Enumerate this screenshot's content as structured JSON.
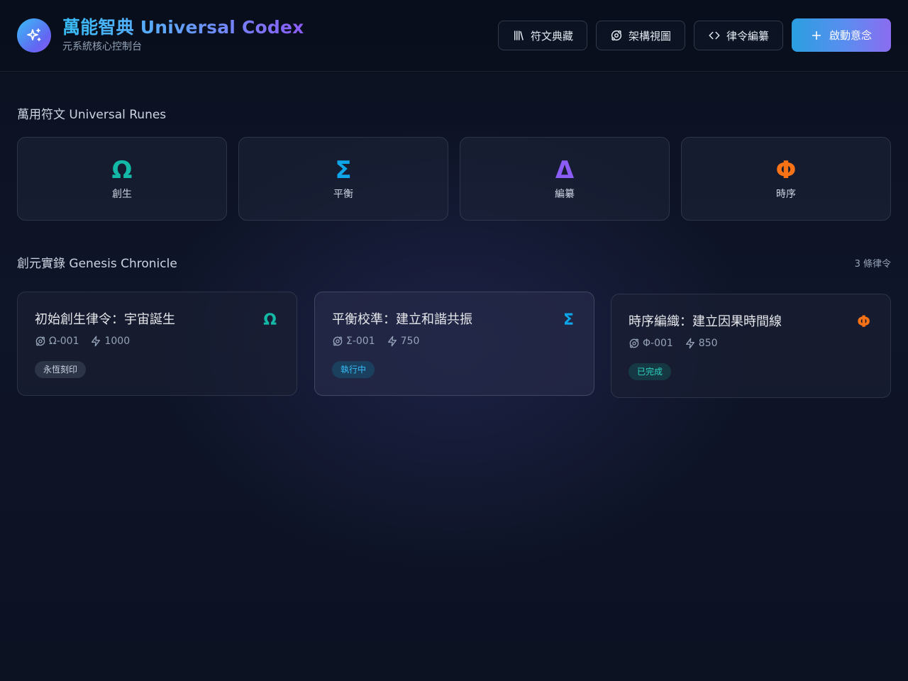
{
  "header": {
    "title": "萬能智典 Universal Codex",
    "subtitle": "元系統核心控制台",
    "logo_icon": "sparkles-icon",
    "nav": [
      {
        "label": "符文典藏",
        "icon": "library-icon"
      },
      {
        "label": "架構視圖",
        "icon": "orbit-icon"
      },
      {
        "label": "律令編纂",
        "icon": "code-icon"
      }
    ],
    "primary": {
      "label": "啟動意念",
      "icon": "plus-icon"
    }
  },
  "runes": {
    "title": "萬用符文 Universal Runes",
    "items": [
      {
        "symbol": "Ω",
        "label": "創生",
        "color": "#14b8a6"
      },
      {
        "symbol": "Σ",
        "label": "平衡",
        "color": "#0ea5e9"
      },
      {
        "symbol": "Δ",
        "label": "編纂",
        "color": "#8b5cf6"
      },
      {
        "symbol": "Φ",
        "label": "時序",
        "color": "#f97316"
      }
    ]
  },
  "chronicle": {
    "title": "創元實錄 Genesis Chronicle",
    "count": "3 條律令",
    "laws": [
      {
        "title": "初始創生律令：宇宙誕生",
        "glyph": "Ω",
        "glyph_color": "#14b8a6",
        "code": "Ω-001",
        "energy": "1000",
        "status": "永恆刻印",
        "status_color": "#cbd5e1",
        "status_bg": "rgba(71,85,105,0.45)"
      },
      {
        "title": "平衡校準：建立和諧共振",
        "glyph": "Σ",
        "glyph_color": "#0ea5e9",
        "code": "Σ-001",
        "energy": "750",
        "status": "執行中",
        "status_color": "#38bdf8",
        "status_bg": "rgba(14,116,144,0.35)"
      },
      {
        "title": "時序編織：建立因果時間線",
        "glyph": "Φ",
        "glyph_color": "#f97316",
        "code": "Φ-001",
        "energy": "850",
        "status": "已完成",
        "status_color": "#2dd4bf",
        "status_bg": "rgba(15,118,110,0.3)"
      }
    ]
  }
}
